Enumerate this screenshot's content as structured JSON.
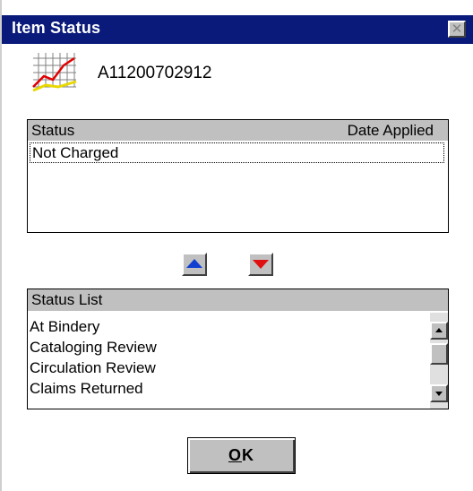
{
  "window": {
    "title": "Item Status",
    "close_glyph": "✕"
  },
  "item": {
    "icon": "chart-icon",
    "id": "A11200702912"
  },
  "status_table": {
    "columns": [
      "Status",
      "Date Applied"
    ],
    "rows": [
      {
        "status": "Not Charged",
        "date_applied": ""
      }
    ]
  },
  "move_buttons": {
    "up_icon": "up-arrow-icon",
    "down_icon": "down-arrow-icon"
  },
  "status_list": {
    "header": "Status List",
    "items": [
      "At Bindery",
      "Cataloging Review",
      "Circulation Review",
      "Claims Returned"
    ]
  },
  "ok_button": {
    "mnemonic": "O",
    "rest": "K"
  },
  "colors": {
    "titlebar": "#0a1a7a",
    "up_arrow": "#1040d0",
    "down_arrow": "#e01010"
  }
}
